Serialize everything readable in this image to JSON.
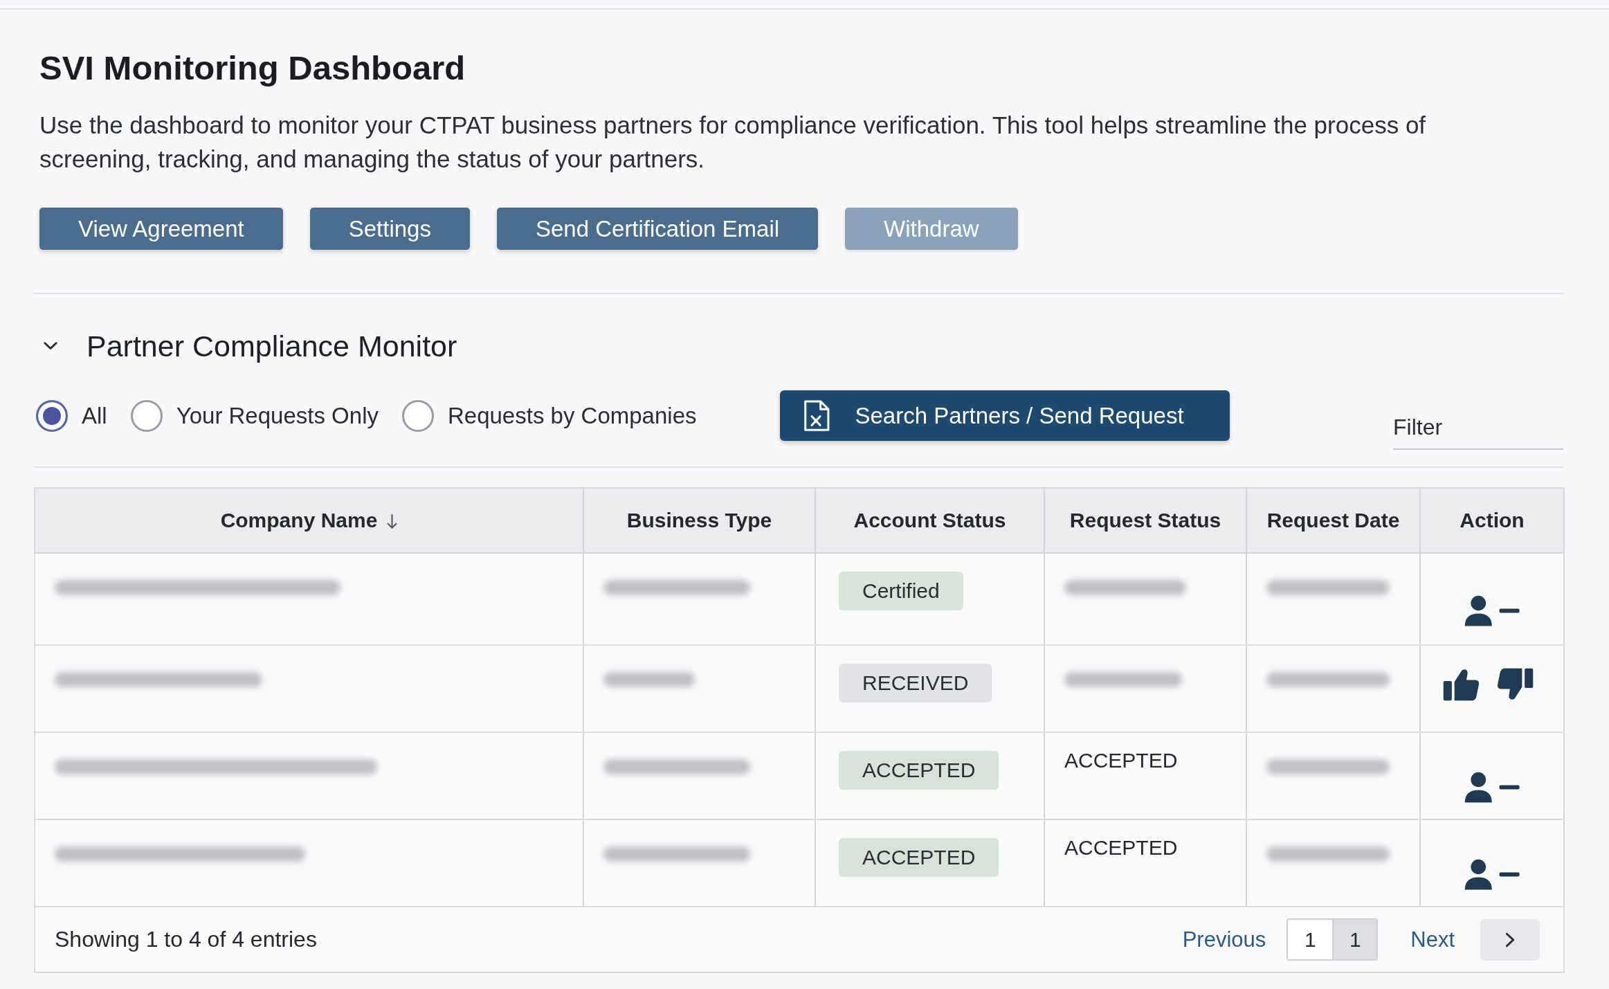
{
  "page": {
    "title": "SVI Monitoring Dashboard",
    "description": "Use the dashboard to monitor your CTPAT business partners for compliance verification. This tool helps streamline the process of screening, tracking, and managing the status of your partners."
  },
  "buttons": [
    {
      "label": "View Agreement",
      "disabled": false
    },
    {
      "label": "Settings",
      "disabled": false
    },
    {
      "label": "Send Certification Email",
      "disabled": false
    },
    {
      "label": "Withdraw",
      "disabled": true
    }
  ],
  "section": {
    "title": "Partner Compliance Monitor",
    "expanded": true,
    "request_filter": [
      {
        "label": "All",
        "selected": true
      },
      {
        "label": "Your Requests Only",
        "selected": false
      },
      {
        "label": "Requests by Companies",
        "selected": false
      }
    ],
    "search_button": "Search Partners / Send Request",
    "filter": {
      "placeholder": "Filter"
    },
    "table": {
      "columns": [
        {
          "label": "Company Name",
          "sorted": true
        },
        {
          "label": "Business Type",
          "sorted": false
        },
        {
          "label": "Account Status",
          "sorted": false
        },
        {
          "label": "Request Status",
          "sorted": false
        },
        {
          "label": "Request Date",
          "sorted": false
        },
        {
          "label": "Action",
          "sorted": false
        }
      ],
      "rows": [
        {
          "cells": [
            {
              "kind": "blurred"
            },
            {
              "kind": "blurred"
            },
            {
              "kind": "badge",
              "text": "Certified",
              "color": "#d9e4da"
            },
            {
              "kind": "blurred"
            },
            {
              "kind": "blurred"
            },
            {
              "kind": "actions",
              "actions": [
                {
                  "kind": "remove-user"
                }
              ]
            }
          ]
        },
        {
          "cells": [
            {
              "kind": "blurred"
            },
            {
              "kind": "blurred"
            },
            {
              "kind": "badge",
              "text": "RECEIVED",
              "color": "#e3e4e8"
            },
            {
              "kind": "blurred"
            },
            {
              "kind": "blurred"
            },
            {
              "kind": "actions",
              "actions": [
                {
                  "kind": "thumbs-up"
                },
                {
                  "kind": "thumbs-down"
                }
              ]
            }
          ]
        },
        {
          "cells": [
            {
              "kind": "blurred"
            },
            {
              "kind": "blurred"
            },
            {
              "kind": "badge",
              "text": "ACCEPTED",
              "color": "#d9e2da"
            },
            {
              "kind": "text",
              "text": "ACCEPTED"
            },
            {
              "kind": "blurred"
            },
            {
              "kind": "actions",
              "actions": [
                {
                  "kind": "remove-user"
                }
              ]
            }
          ]
        },
        {
          "cells": [
            {
              "kind": "blurred"
            },
            {
              "kind": "blurred"
            },
            {
              "kind": "badge",
              "text": "ACCEPTED",
              "color": "#d9e2da"
            },
            {
              "kind": "text",
              "text": "ACCEPTED"
            },
            {
              "kind": "blurred"
            },
            {
              "kind": "actions",
              "actions": [
                {
                  "kind": "remove-user"
                }
              ]
            }
          ]
        }
      ],
      "footer": {
        "summary": "Showing 1 to 4 of 4 entries",
        "previous": "Previous",
        "pages": [
          {
            "label": "1",
            "selected": false
          },
          {
            "label": "1",
            "selected": true
          }
        ],
        "next": "Next"
      }
    }
  }
}
